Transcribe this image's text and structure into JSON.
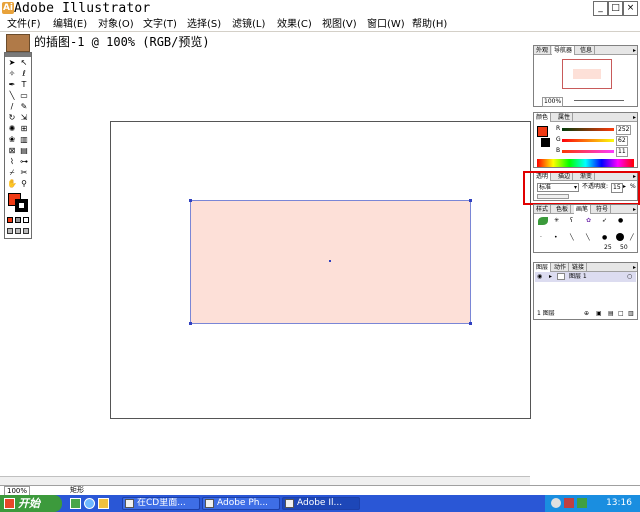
{
  "window": {
    "title": "Adobe Illustrator",
    "controls": {
      "minimize": "_",
      "maximize": "□",
      "close": "×"
    }
  },
  "menubar": {
    "items": [
      "文件(F)",
      "编辑(E)",
      "对象(O)",
      "文字(T)",
      "选择(S)",
      "滤镜(L)",
      "效果(C)",
      "视图(V)",
      "窗口(W)",
      "帮助(H)"
    ]
  },
  "document": {
    "title": "的插图-1 @ 100% (RGB/预览)"
  },
  "toolbox": {
    "fill_color": "#f03a14",
    "stroke_color": "#000000",
    "tools": [
      "selection",
      "direct-selection",
      "magic-wand",
      "lasso",
      "pen",
      "type",
      "line",
      "rectangle",
      "paintbrush",
      "pencil",
      "rotate",
      "scale",
      "warp",
      "free-transform",
      "symbol-sprayer",
      "graph",
      "mesh",
      "gradient",
      "eyedropper",
      "blend",
      "slice",
      "scissors",
      "hand",
      "zoom"
    ]
  },
  "panels": {
    "navigator": {
      "tabs": [
        "外观",
        "导航器",
        "信息"
      ],
      "zoom": "100%"
    },
    "color": {
      "tabs": [
        "颜色",
        "属性"
      ],
      "channels": [
        {
          "label": "R",
          "value": "252"
        },
        {
          "label": "G",
          "value": "62"
        },
        {
          "label": "B",
          "value": "11"
        }
      ]
    },
    "transparency": {
      "tabs": [
        "透明",
        "描边",
        "渐变"
      ],
      "blend_mode": "标准",
      "opacity_label": "不透明度:",
      "opacity_value": "15",
      "opacity_unit": "%"
    },
    "styles": {
      "tabs": [
        "样式",
        "色板",
        "画笔",
        "符号"
      ],
      "brush_sizes": [
        "25",
        "50"
      ]
    },
    "layers": {
      "tabs": [
        "图层",
        "动作",
        "链接"
      ],
      "layer_name": "图层 1",
      "count_label": "1 图层"
    }
  },
  "statusbar": {
    "zoom": "100%",
    "tool": "矩形"
  },
  "taskbar": {
    "start_label": "开始",
    "buttons": [
      "在CD里面...",
      "Adobe Ph...",
      "Adobe Il..."
    ],
    "active_index": 2,
    "clock": "13:16"
  }
}
